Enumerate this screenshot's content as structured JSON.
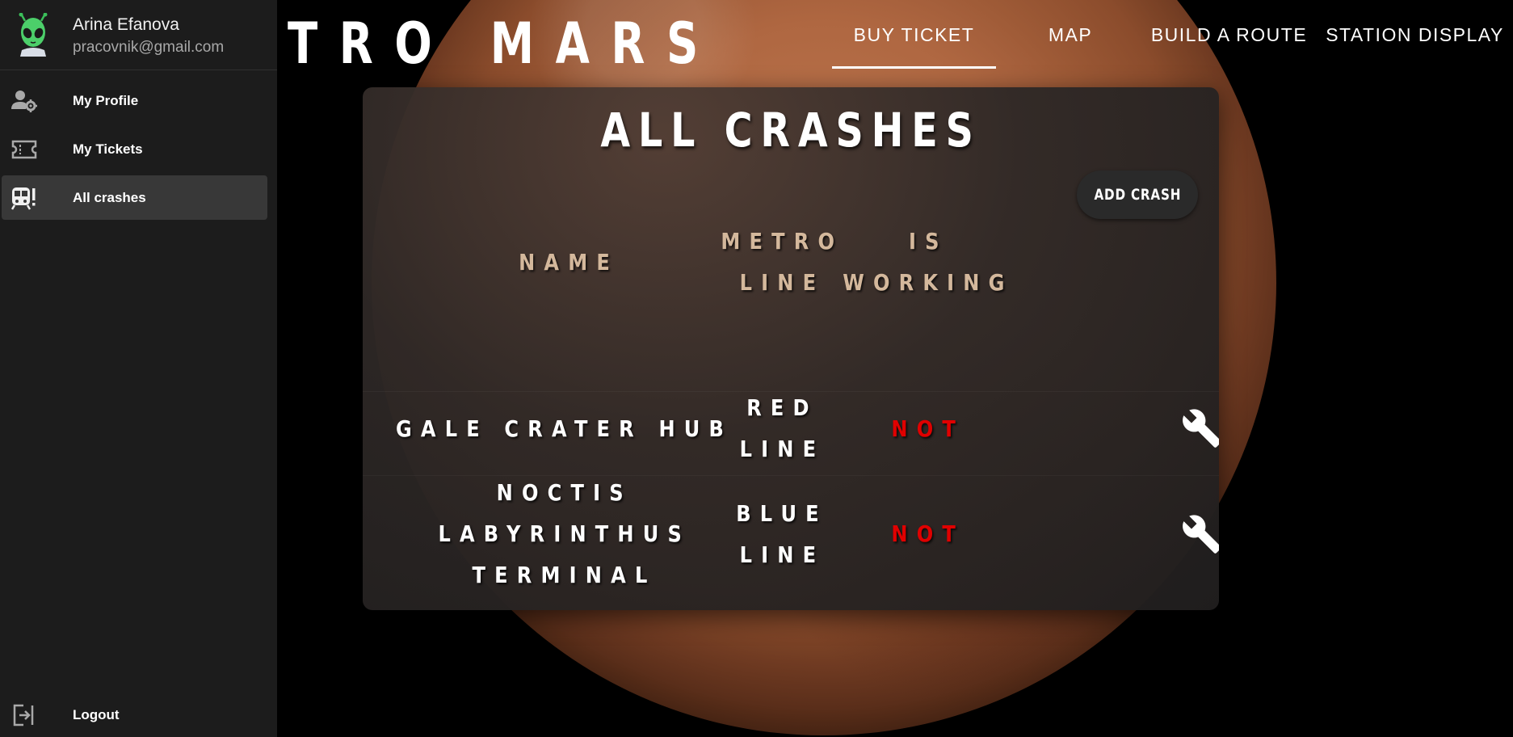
{
  "user": {
    "name": "Arina Efanova",
    "email": "pracovnik@gmail.com",
    "avatar_icon": "alien-avatar-icon"
  },
  "sidebar": {
    "items": [
      {
        "label": "My Profile",
        "icon": "user-gear-icon",
        "active": false
      },
      {
        "label": "My Tickets",
        "icon": "ticket-icon",
        "active": false
      },
      {
        "label": "All crashes",
        "icon": "train-alert-icon",
        "active": true
      }
    ],
    "logout": {
      "label": "Logout",
      "icon": "logout-icon"
    }
  },
  "header": {
    "brand": "TRO MARS",
    "tabs": [
      {
        "label": "BUY TICKET",
        "active": true
      },
      {
        "label": "MAP",
        "active": false
      },
      {
        "label": "BUILD A ROUTE",
        "active": false
      },
      {
        "label": "STATION DISPLAY",
        "active": false
      }
    ]
  },
  "main": {
    "title": "ALL CRASHES",
    "add_button": "ADD CRASH",
    "columns": {
      "name": "NAME",
      "metro_line_1": "METRO",
      "metro_line_2": "LINE",
      "is_working_1": "IS",
      "is_working_2": "WORKING"
    },
    "rows": [
      {
        "name_lines": [
          "GALE CRATER HUB"
        ],
        "line_lines": [
          "RED",
          "LINE"
        ],
        "status": "NOT",
        "action_icon": "wrench-icon"
      },
      {
        "name_lines": [
          "NOCTIS",
          "LABYRINTHUS",
          "TERMINAL"
        ],
        "line_lines": [
          "BLUE",
          "LINE"
        ],
        "status": "NOT",
        "action_icon": "wrench-icon"
      }
    ]
  },
  "colors": {
    "sidebar_bg": "#1c1c1c",
    "active_item_bg": "#383838",
    "header_text": "#d4b89c",
    "status_not": "#e00000"
  }
}
